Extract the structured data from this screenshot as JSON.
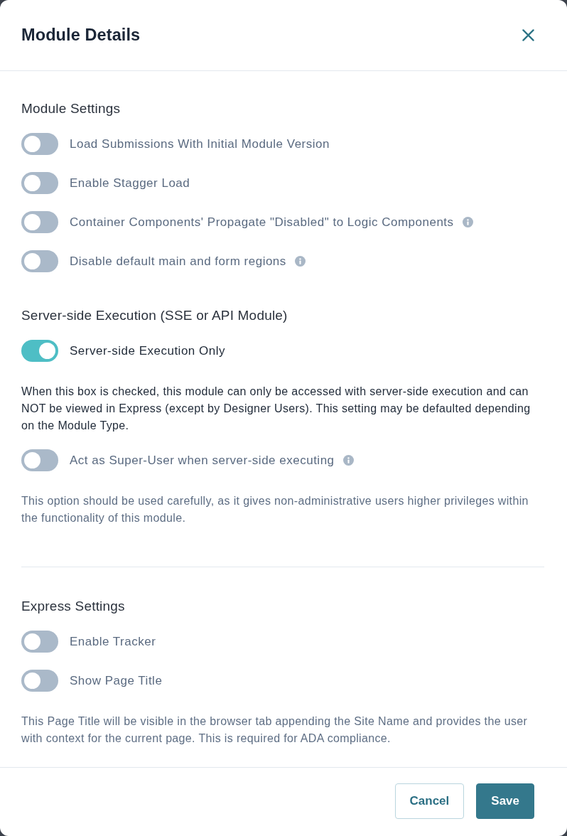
{
  "dialog": {
    "title": "Module Details"
  },
  "sections": [
    {
      "heading": "Module Settings",
      "divider_above": false,
      "items": [
        {
          "label": "Load Submissions With Initial Module Version",
          "on": false,
          "info": false
        },
        {
          "label": "Enable Stagger Load",
          "on": false,
          "info": false
        },
        {
          "label": "Container Components' Propagate \"Disabled\" to Logic Components",
          "on": false,
          "info": true
        },
        {
          "label": "Disable default main and form regions",
          "on": false,
          "info": true
        }
      ]
    },
    {
      "heading": "Server-side Execution (SSE or API Module)",
      "divider_above": false,
      "items": [
        {
          "label": "Server-side Execution Only",
          "on": true,
          "info": false,
          "description": "When this box is checked, this module can only be accessed with server-side execution and can NOT be viewed in Express (except by Designer Users). This setting may be defaulted depending on the Module Type."
        },
        {
          "label": "Act as Super-User when server-side executing",
          "on": false,
          "info": true,
          "description": "This option should be used carefully, as it gives non-administrative users higher privileges within the functionality of this module."
        }
      ]
    },
    {
      "heading": "Express Settings",
      "divider_above": true,
      "items": [
        {
          "label": "Enable Tracker",
          "on": false,
          "info": false
        },
        {
          "label": "Show Page Title",
          "on": false,
          "info": false,
          "description": "This Page Title will be visible in the browser tab appending the Site Name and provides the user with context for the current page. This is required for ADA compliance."
        }
      ]
    }
  ],
  "buttons": [
    {
      "label": "Cancel",
      "kind": "secondary"
    },
    {
      "label": "Save",
      "kind": "primary"
    }
  ]
}
